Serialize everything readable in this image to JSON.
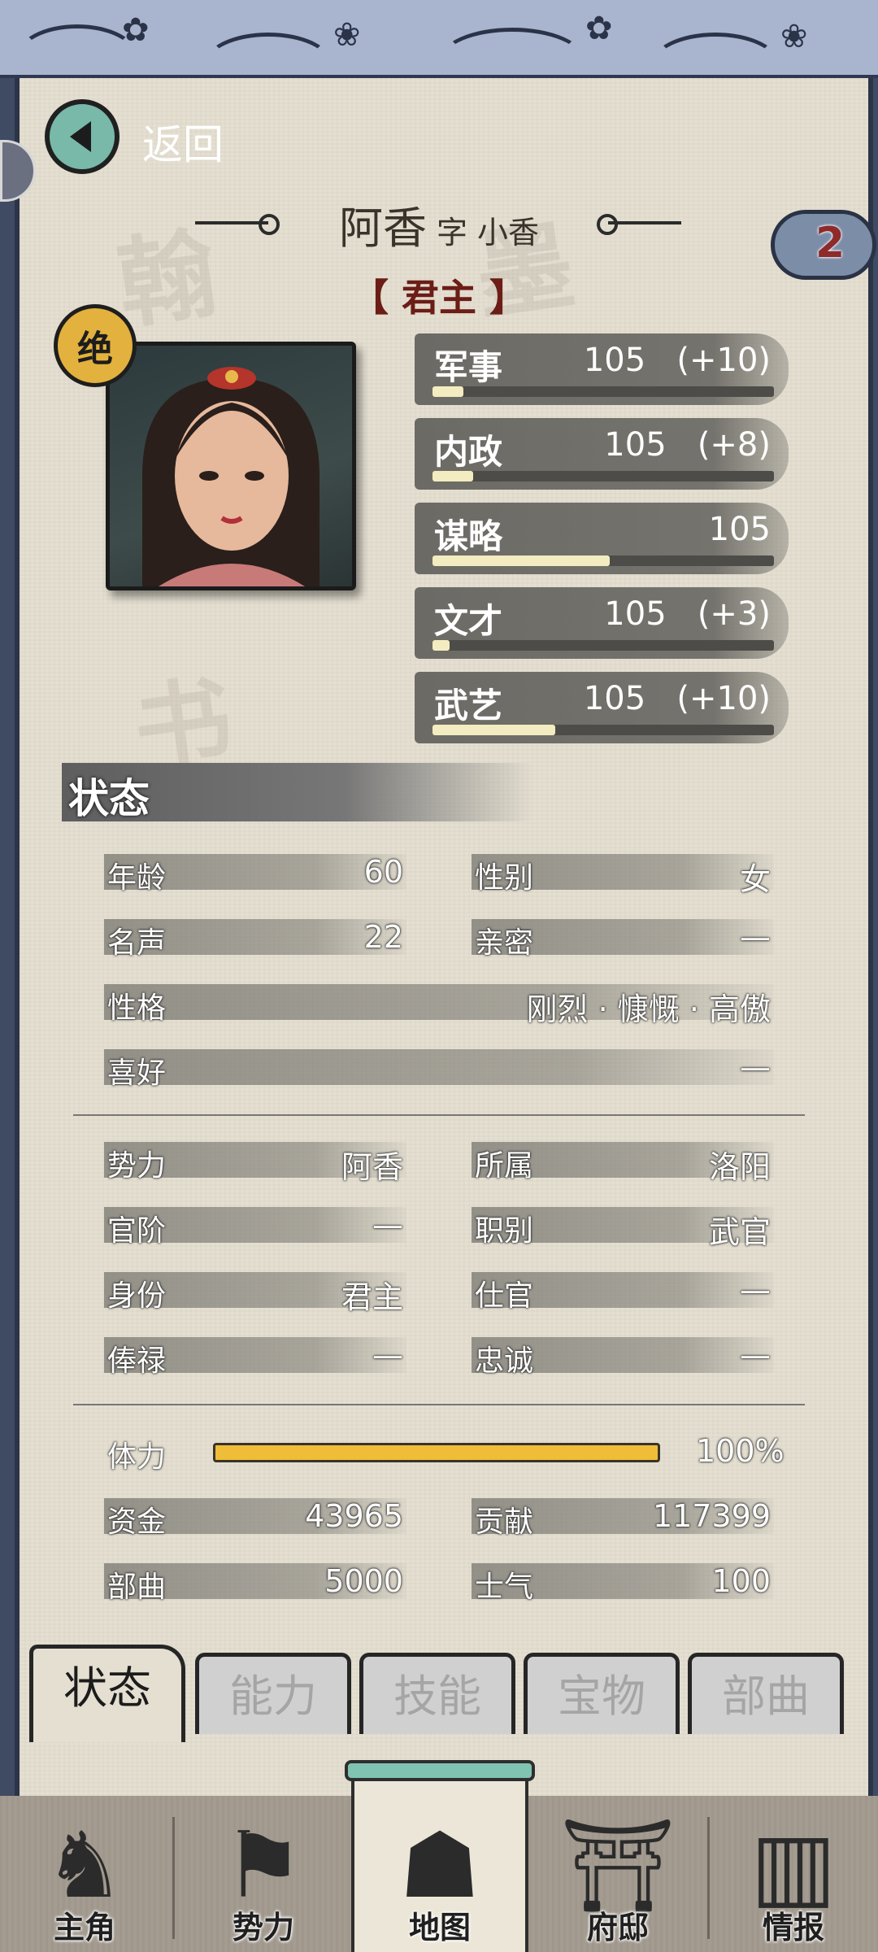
{
  "header": {
    "back_label": "返回"
  },
  "character": {
    "name": "阿香",
    "courtesy": "字 小香",
    "title": "【 君主 】",
    "grade_badge": "绝",
    "cloud_badge_number": "2"
  },
  "attributes": [
    {
      "name": "军事",
      "value": "105",
      "bonus": "(+10)",
      "bar": 0.09
    },
    {
      "name": "内政",
      "value": "105",
      "bonus": "(+8)",
      "bar": 0.12
    },
    {
      "name": "谋略",
      "value": "105",
      "bonus": "",
      "bar": 0.52
    },
    {
      "name": "文才",
      "value": "105",
      "bonus": "(+3)",
      "bar": 0.05
    },
    {
      "name": "武艺",
      "value": "105",
      "bonus": "(+10)",
      "bar": 0.36
    }
  ],
  "status": {
    "section_title": "状态",
    "age": {
      "label": "年龄",
      "value": "60"
    },
    "gender": {
      "label": "性别",
      "value": "女"
    },
    "fame": {
      "label": "名声",
      "value": "22"
    },
    "intimacy": {
      "label": "亲密",
      "value": "—"
    },
    "personality": {
      "label": "性格",
      "value": "刚烈 · 慷慨 · 高傲"
    },
    "hobby": {
      "label": "喜好",
      "value": "—"
    },
    "faction": {
      "label": "势力",
      "value": "阿香"
    },
    "location": {
      "label": "所属",
      "value": "洛阳"
    },
    "rank": {
      "label": "官阶",
      "value": "—"
    },
    "post": {
      "label": "职别",
      "value": "武官"
    },
    "identity": {
      "label": "身份",
      "value": "君主"
    },
    "office": {
      "label": "仕官",
      "value": "—"
    },
    "salary": {
      "label": "俸禄",
      "value": "—"
    },
    "loyalty": {
      "label": "忠诚",
      "value": "—"
    },
    "stamina": {
      "label": "体力",
      "value": "100%",
      "level": 1.0
    },
    "funds": {
      "label": "资金",
      "value": "43965"
    },
    "contribution": {
      "label": "贡献",
      "value": "117399"
    },
    "troops": {
      "label": "部曲",
      "value": "5000"
    },
    "morale": {
      "label": "士气",
      "value": "100"
    }
  },
  "tabs": [
    "状态",
    "能力",
    "技能",
    "宝物",
    "部曲"
  ],
  "nav": [
    "主角",
    "势力",
    "地图",
    "府邸",
    "情报"
  ],
  "colors": {
    "accent": "#f0bd38",
    "title_red": "#6b1d16",
    "back_teal": "#78b9a9"
  }
}
